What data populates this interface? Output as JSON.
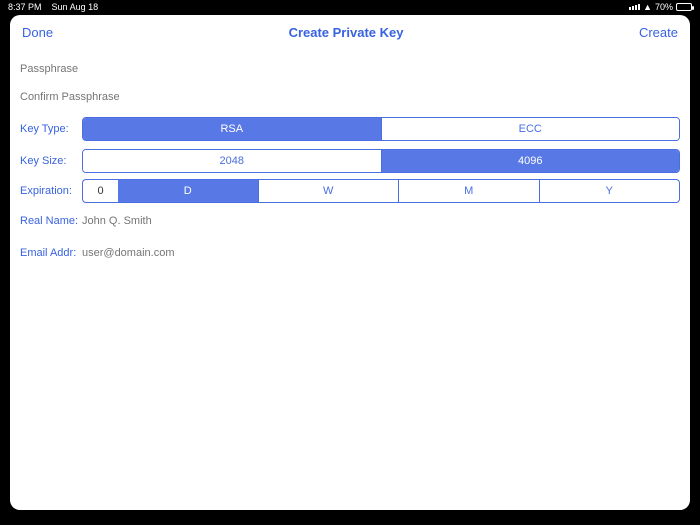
{
  "status": {
    "time": "8:37 PM",
    "date": "Sun Aug 18",
    "battery_pct": "70%"
  },
  "nav": {
    "left": "Done",
    "title": "Create Private Key",
    "right": "Create"
  },
  "fields": {
    "passphrase_placeholder": "Passphrase",
    "confirm_placeholder": "Confirm Passphrase",
    "key_type_label": "Key Type:",
    "key_type_options": {
      "rsa": "RSA",
      "ecc": "ECC"
    },
    "key_size_label": "Key Size:",
    "key_size_options": {
      "a": "2048",
      "b": "4096"
    },
    "expiration_label": "Expiration:",
    "expiration_value": "0",
    "expiration_units": {
      "d": "D",
      "w": "W",
      "m": "M",
      "y": "Y"
    },
    "real_name_label": "Real Name:",
    "real_name_placeholder": "John Q. Smith",
    "email_label": "Email Addr:",
    "email_placeholder": "user@domain.com"
  }
}
